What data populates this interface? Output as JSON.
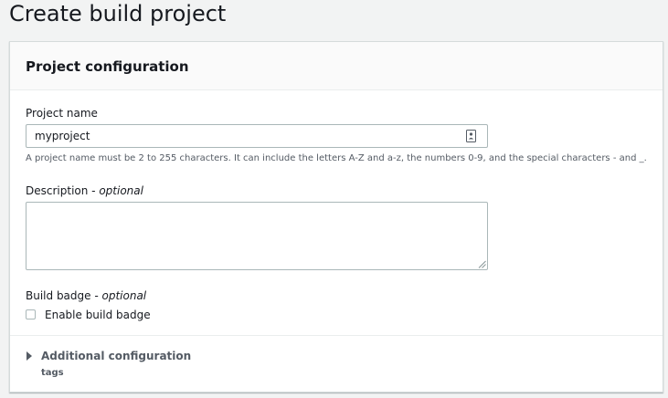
{
  "page": {
    "title": "Create build project"
  },
  "section": {
    "title": "Project configuration"
  },
  "project_name": {
    "label": "Project name",
    "value": "myproject",
    "hint": "A project name must be 2 to 255 characters. It can include the letters A-Z and a-z, the numbers 0-9, and the special characters - and _."
  },
  "description": {
    "label": "Description",
    "optional_suffix": "- optional",
    "value": ""
  },
  "build_badge": {
    "label": "Build badge",
    "optional_suffix": "- optional",
    "checkbox_label": "Enable build badge",
    "checked": false
  },
  "additional_configuration": {
    "label": "Additional configuration",
    "subtext": "tags",
    "expanded": false
  },
  "icons": {
    "input_icon": "contact-card-icon",
    "expander_icon": "caret-right-icon",
    "resize_icon": "resize-grip-icon"
  }
}
